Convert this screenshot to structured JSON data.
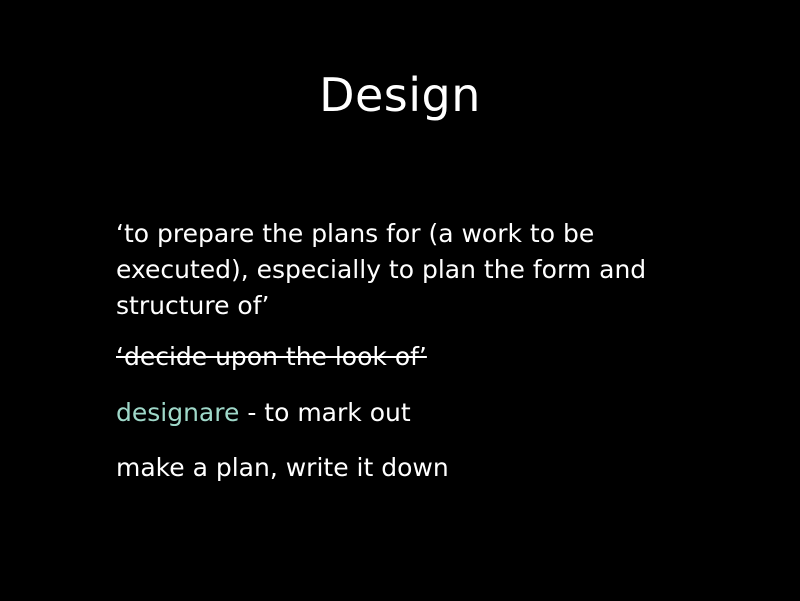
{
  "slide": {
    "title": "Design",
    "definition_lines": [
      "‘to prepare the plans for (a work to be",
      "executed), especially to plan the form and",
      "structure of’"
    ],
    "struck_text": "‘decide upon the look of’",
    "etymology": {
      "latin_word": "designare",
      "meaning": " - to mark out"
    },
    "summary": "make a plan, write it down"
  },
  "colors": {
    "background": "#000000",
    "text": "#ffffff",
    "latin_accent": "#9fd8c9"
  }
}
